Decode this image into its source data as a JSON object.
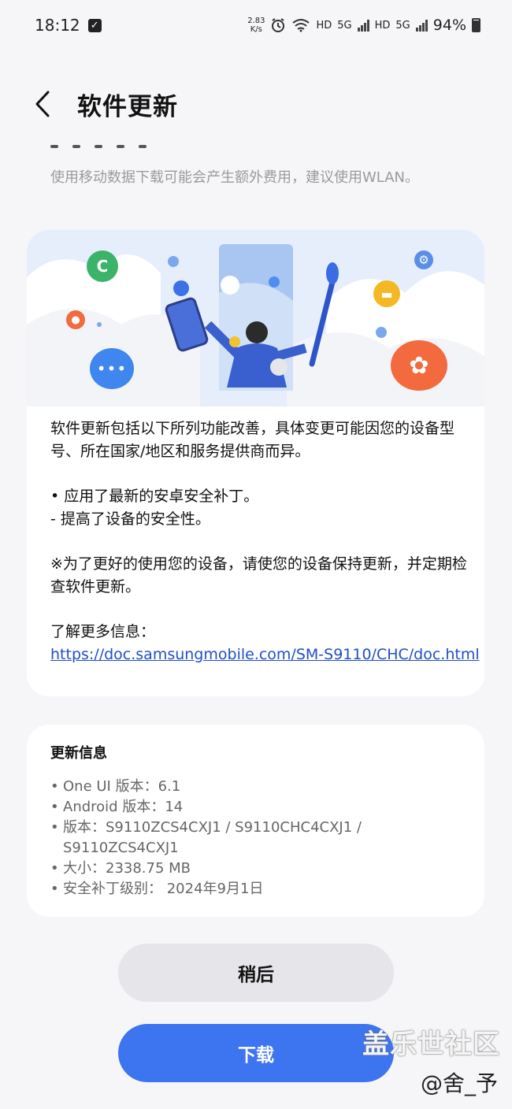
{
  "status_bar": {
    "time": "18:12",
    "net_speed_value": "2.83",
    "net_speed_unit": "K/s",
    "hd1": "HD",
    "net1": "5G",
    "hd2": "HD",
    "net2": "5G",
    "battery": "94%"
  },
  "header": {
    "title": "软件更新"
  },
  "notice": "使用移动数据下载可能会产生额外费用，建议使用WLAN。",
  "description": {
    "intro": "软件更新包括以下所列功能改善，具体变更可能因您的设备型号、所在国家/地区和服务提供商而异。",
    "bullet1": "• 应用了最新的安卓安全补丁。",
    "bullet2": "- 提高了设备的安全性。",
    "advice": "※为了更好的使用您的设备，请使您的设备保持更新，并定期检查软件更新。",
    "more_info": "了解更多信息：",
    "link": "https://doc.samsungmobile.com/SM-S9110/CHC/doc.html"
  },
  "update_info": {
    "title": "更新信息",
    "items": [
      "One UI 版本：6.1",
      "Android 版本：14",
      "版本：S9110ZCS4CXJ1 / S9110CHC4CXJ1 / S9110ZCS4CXJ1",
      "大小：2338.75 MB",
      "安全补丁级别： 2024年9月1日"
    ]
  },
  "buttons": {
    "later": "稍后",
    "download": "下载"
  },
  "watermark": {
    "brand": "盖乐世社区",
    "user": "@舍_予"
  },
  "colors": {
    "accent": "#3d74f0",
    "link": "#1f4fc8",
    "background": "#f6f6f9"
  },
  "icons": [
    "checkbox-icon",
    "alarm-icon",
    "wifi-icon",
    "signal-icon",
    "battery-icon",
    "back-icon",
    "phone-icon",
    "chat-icon",
    "flower-icon",
    "gear-icon",
    "folder-icon",
    "person-icon"
  ]
}
